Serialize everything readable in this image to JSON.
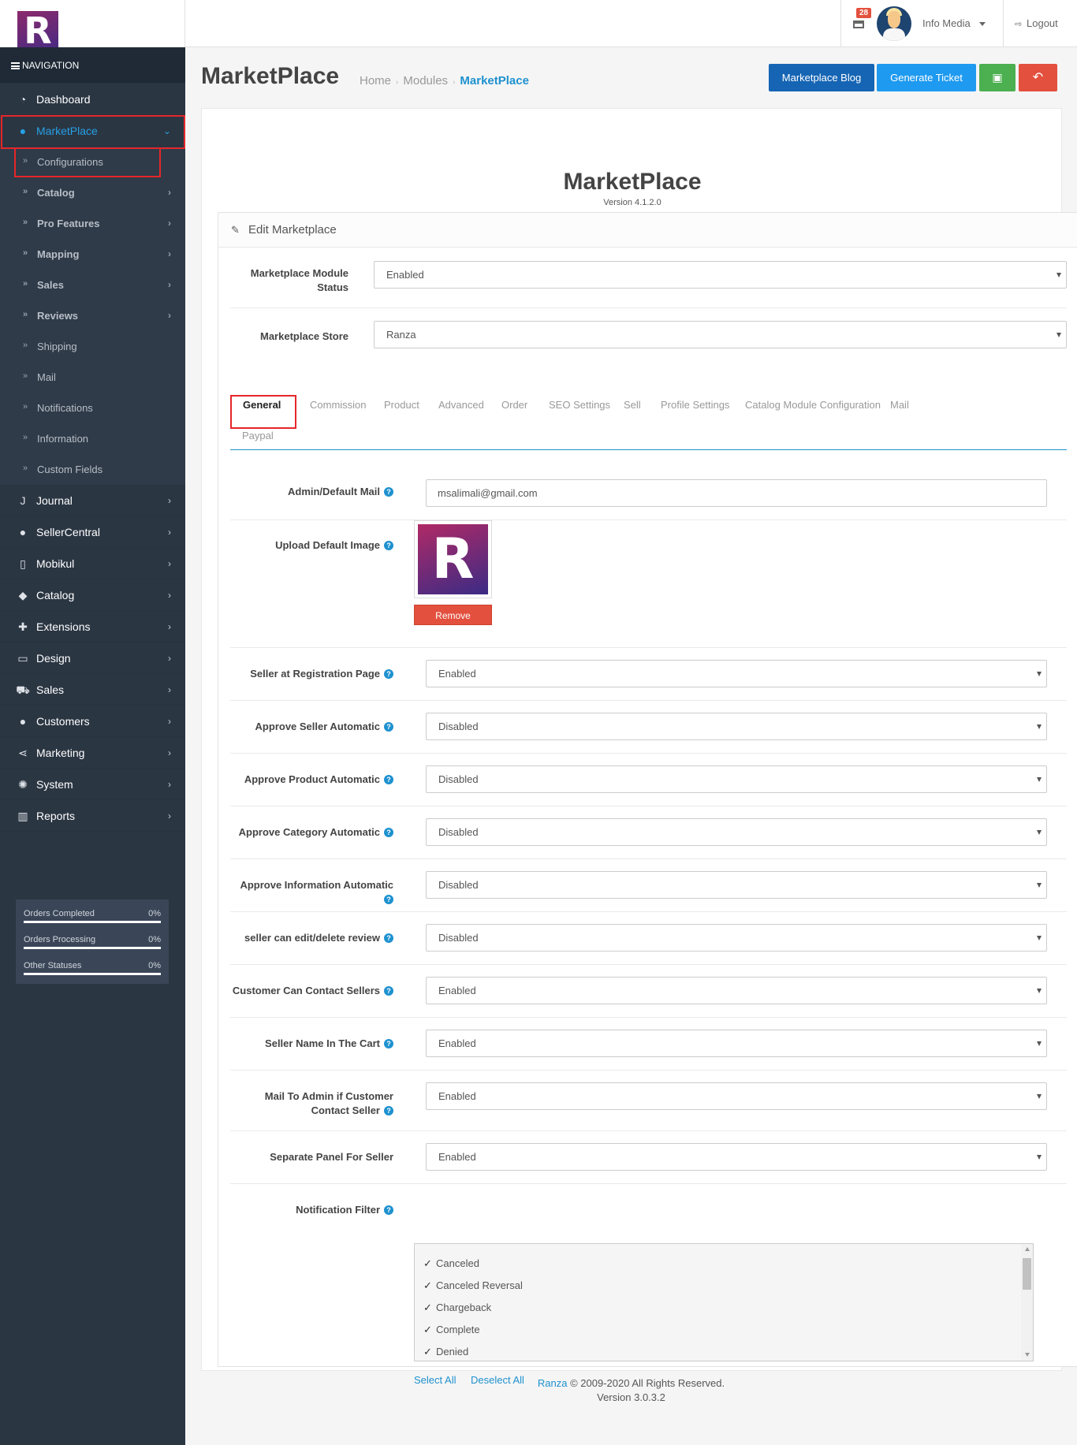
{
  "header": {
    "notification_count": "28",
    "user_name": "Info Media",
    "logout_label": "Logout"
  },
  "sidebar": {
    "nav_title": "NAVIGATION",
    "dashboard": "Dashboard",
    "marketplace": "MarketPlace",
    "marketplace_sub": [
      "Configurations",
      "Catalog",
      "Pro Features",
      "Mapping",
      "Sales",
      "Reviews",
      "Shipping",
      "Mail",
      "Notifications",
      "Information",
      "Custom Fields"
    ],
    "menu": [
      "Journal",
      "SellerCentral",
      "Mobikul",
      "Catalog",
      "Extensions",
      "Design",
      "Sales",
      "Customers",
      "Marketing",
      "System",
      "Reports"
    ],
    "stats": [
      {
        "label": "Orders Completed",
        "value": "0%"
      },
      {
        "label": "Orders Processing",
        "value": "0%"
      },
      {
        "label": "Other Statuses",
        "value": "0%"
      }
    ]
  },
  "page": {
    "title": "MarketPlace",
    "breadcrumb": [
      "Home",
      "Modules",
      "MarketPlace"
    ],
    "buttons": {
      "blog": "Marketplace Blog",
      "ticket": "Generate Ticket"
    }
  },
  "panel": {
    "module_title": "MarketPlace",
    "version": "Version 4.1.2.0",
    "edit_heading": "Edit Marketplace",
    "module_status_label": "Marketplace Module Status",
    "module_status_value": "Enabled",
    "store_label": "Marketplace Store",
    "store_value": "Ranza",
    "tabs": [
      "General",
      "Commission",
      "Product",
      "Advanced",
      "Order",
      "SEO Settings",
      "Sell",
      "Profile Settings",
      "Catalog Module Configuration",
      "Mail",
      "Paypal"
    ],
    "admin_mail_label": "Admin/Default Mail",
    "admin_mail_value": "msalimali@gmail.com",
    "upload_image_label": "Upload Default Image",
    "remove_label": "Remove",
    "settings": [
      {
        "label": "Seller at Registration Page",
        "value": "Enabled"
      },
      {
        "label": "Approve Seller Automatic",
        "value": "Disabled"
      },
      {
        "label": "Approve Product Automatic",
        "value": "Disabled"
      },
      {
        "label": "Approve Category Automatic",
        "value": "Disabled"
      },
      {
        "label": "Approve Information Automatic",
        "value": "Disabled"
      },
      {
        "label": "seller can edit/delete review",
        "value": "Disabled"
      },
      {
        "label": "Customer Can Contact Sellers",
        "value": "Enabled"
      },
      {
        "label": "Seller Name In The Cart",
        "value": "Enabled"
      },
      {
        "label": "Mail To Admin if Customer Contact Seller",
        "value": "Enabled"
      },
      {
        "label": "Separate Panel For Seller",
        "value": "Enabled"
      }
    ],
    "notification_filter_label": "Notification Filter",
    "notification_options": [
      "Canceled",
      "Canceled Reversal",
      "Chargeback",
      "Complete",
      "Denied"
    ],
    "select_all": "Select All",
    "deselect_all": "Deselect All"
  },
  "footer": {
    "brand": "Ranza",
    "copyright": "© 2009-2020 All Rights Reserved.",
    "version": "Version 3.0.3.2"
  },
  "colors": {
    "sidebar": "#2b3643",
    "accent": "#1e91cf",
    "danger": "#e3503e",
    "success": "#4caf50"
  }
}
